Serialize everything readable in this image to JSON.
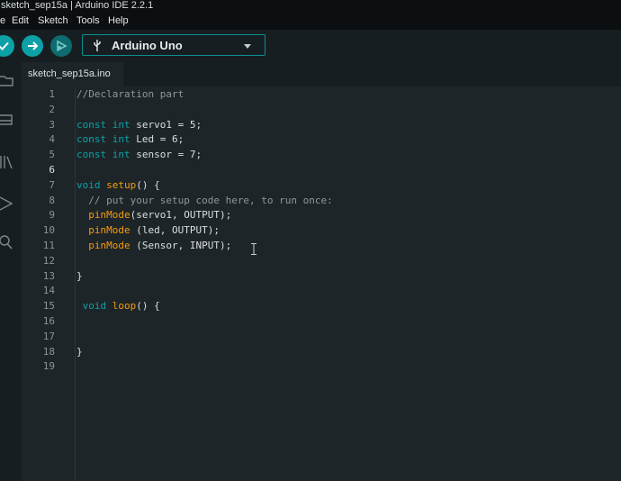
{
  "window": {
    "title": "sketch_sep15a | Arduino IDE 2.2.1"
  },
  "menu": [
    "e",
    "Edit",
    "Sketch",
    "Tools",
    "Help"
  ],
  "toolbar": {
    "board": "Arduino Uno",
    "icons": {
      "verify": "check-icon",
      "upload": "arrow-right-icon",
      "debug": "debug-icon"
    },
    "accent": "#0ca1a6"
  },
  "tab": {
    "name": "sketch_sep15a.ino"
  },
  "editor": {
    "current_line": 6,
    "lines": [
      {
        "n": "1",
        "code": "//Declaration part"
      },
      {
        "n": "2",
        "code": ""
      },
      {
        "n": "3",
        "code": "const int servo1 = 5;"
      },
      {
        "n": "4",
        "code": "const int Led = 6;"
      },
      {
        "n": "5",
        "code": "const int sensor = 7;"
      },
      {
        "n": "6",
        "code": ""
      },
      {
        "n": "7",
        "code": "void setup() {"
      },
      {
        "n": "8",
        "code": "  // put your setup code here, to run once:"
      },
      {
        "n": "9",
        "code": "  pinMode(servo1, OUTPUT);"
      },
      {
        "n": "10",
        "code": "  pinMode (led, OUTPUT);"
      },
      {
        "n": "11",
        "code": "  pinMode (Sensor, INPUT);"
      },
      {
        "n": "12",
        "code": ""
      },
      {
        "n": "13",
        "code": "}"
      },
      {
        "n": "14",
        "code": ""
      },
      {
        "n": "15",
        "code": " void loop() {"
      },
      {
        "n": "16",
        "code": ""
      },
      {
        "n": "17",
        "code": ""
      },
      {
        "n": "18",
        "code": "}"
      },
      {
        "n": "19",
        "code": ""
      }
    ]
  }
}
